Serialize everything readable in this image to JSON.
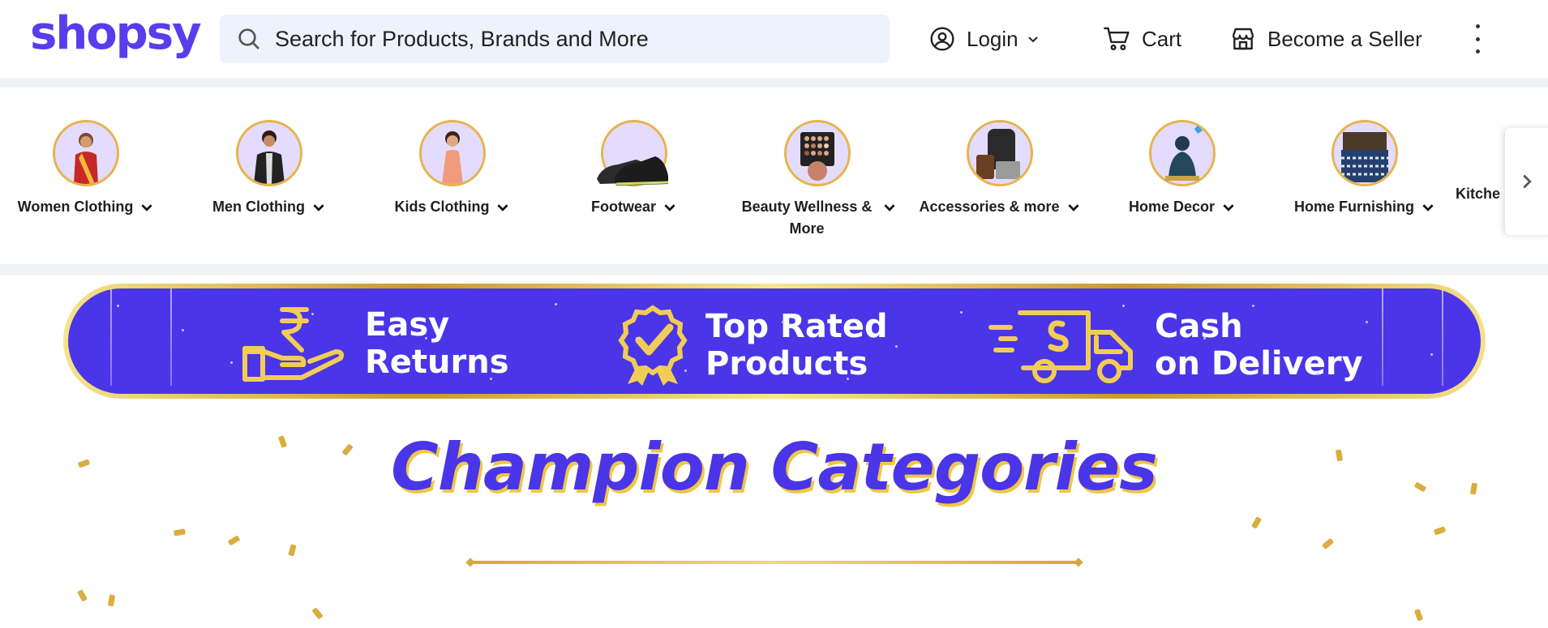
{
  "header": {
    "logo": "shopsy",
    "search_placeholder": "Search for Products, Brands and More",
    "login_label": "Login",
    "cart_label": "Cart",
    "seller_label": "Become a Seller"
  },
  "categories": [
    {
      "label": "Women Clothing",
      "icon": "women-clothing-image"
    },
    {
      "label": "Men Clothing",
      "icon": "men-clothing-image"
    },
    {
      "label": "Kids Clothing",
      "icon": "kids-clothing-image"
    },
    {
      "label": "Footwear",
      "icon": "footwear-image"
    },
    {
      "label": "Beauty Wellness & More",
      "icon": "beauty-image"
    },
    {
      "label": "Accessories & more",
      "icon": "accessories-image"
    },
    {
      "label": "Home Decor",
      "icon": "home-decor-image"
    },
    {
      "label": "Home Furnishing",
      "icon": "home-furnishing-image"
    },
    {
      "label": "Kitche",
      "icon": "kitchen-image"
    }
  ],
  "banner": {
    "features": [
      {
        "line1": "Easy",
        "line2": "Returns",
        "icon": "rupee-hand-icon"
      },
      {
        "line1": "Top Rated",
        "line2": "Products",
        "icon": "badge-check-icon"
      },
      {
        "line1": "Cash",
        "line2": "on Delivery",
        "icon": "delivery-truck-icon"
      }
    ]
  },
  "section": {
    "title": "Champion Categories"
  },
  "colors": {
    "brand": "#5a3cec",
    "banner_bg": "#4a35e8",
    "gold": "#e8b34f"
  }
}
